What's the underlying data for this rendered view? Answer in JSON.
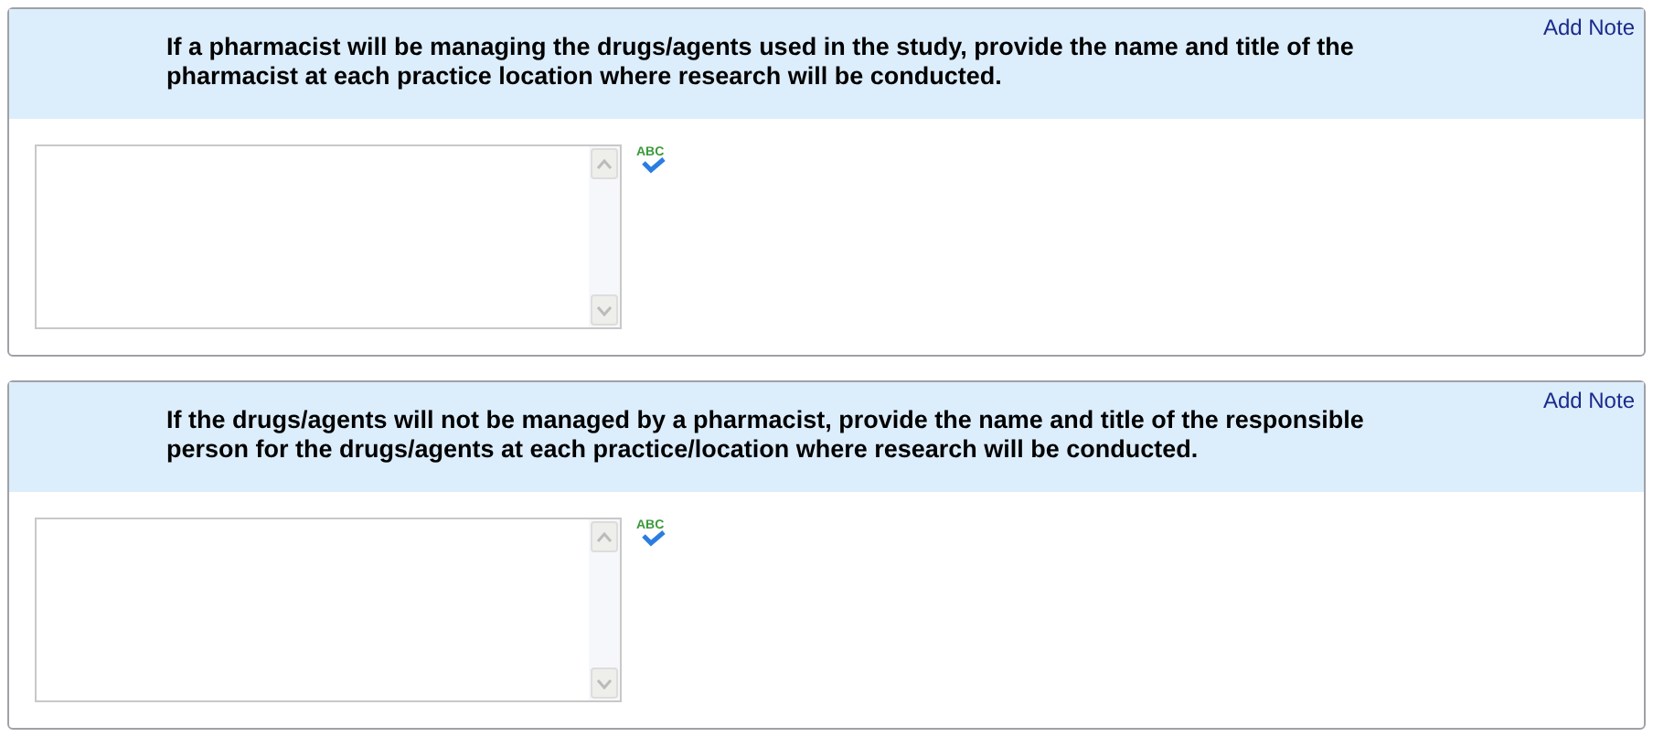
{
  "questions": [
    {
      "add_note": "Add Note",
      "prompt": "If a pharmacist will be managing the drugs/agents used in the study, provide the name and title of the pharmacist at each practice location where research will be conducted.",
      "spell_check_label": "ABC"
    },
    {
      "add_note": "Add Note",
      "prompt": "If the drugs/agents will not be managed by a pharmacist, provide the name and title of the responsible person for the drugs/agents at each practice/location where research will be conducted.",
      "spell_check_label": "ABC"
    }
  ]
}
